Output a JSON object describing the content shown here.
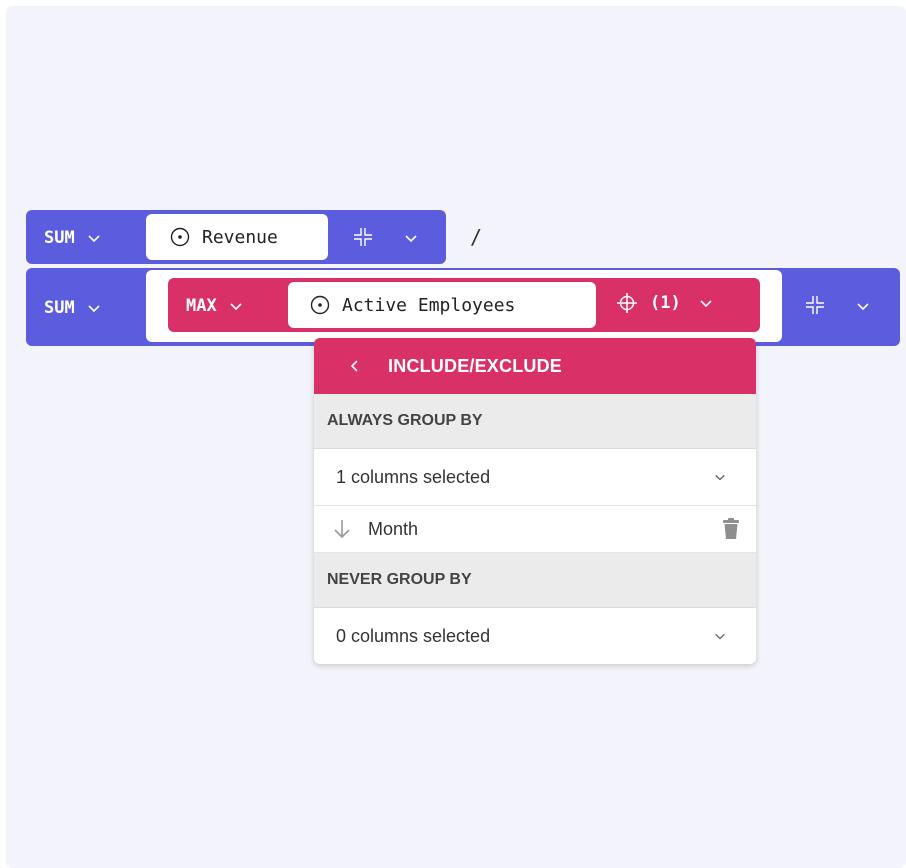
{
  "row1": {
    "aggregation": "SUM",
    "field": "Revenue",
    "operator": "/"
  },
  "row2": {
    "aggregation": "SUM",
    "inner": {
      "aggregation": "MAX",
      "field": "Active Employees",
      "filter_count": "(1)"
    }
  },
  "popup": {
    "title": "INCLUDE/EXCLUDE",
    "always_group_by": {
      "heading": "ALWAYS GROUP BY",
      "selected_text": "1 columns selected",
      "columns": [
        {
          "name": "Month"
        }
      ]
    },
    "never_group_by": {
      "heading": "NEVER GROUP BY",
      "selected_text": "0 columns selected"
    }
  },
  "colors": {
    "primary": "#5b5cde",
    "accent": "#d93167",
    "background": "#f3f4fb"
  },
  "icons": [
    "chevron-down-icon",
    "target-circle-icon",
    "expand-icon",
    "crosshair-icon",
    "chevron-left-icon",
    "arrow-down-icon",
    "trash-icon"
  ]
}
